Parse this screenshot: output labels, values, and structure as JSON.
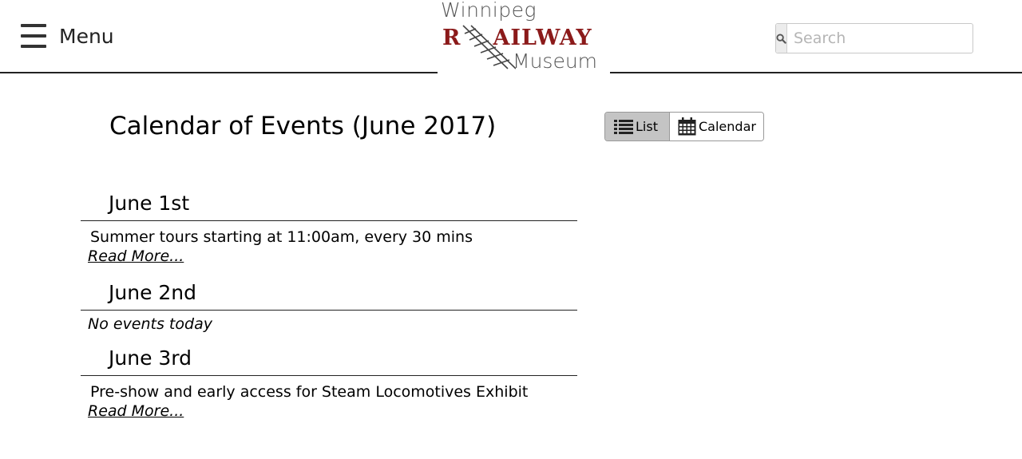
{
  "header": {
    "menu_label": "Menu",
    "logo": {
      "line1": "Winnipeg",
      "line2_left": "R",
      "line2_right": "AILWAY",
      "line3": "Museum"
    },
    "search": {
      "placeholder": "Search",
      "value": ""
    }
  },
  "colors": {
    "logo_red": "#8b1a1a",
    "active_toggle": "#c4c4c4"
  },
  "page": {
    "title": "Calendar of Events (June 2017)",
    "view_toggle": {
      "list_label": "List",
      "calendar_label": "Calendar",
      "active": "List"
    },
    "days": [
      {
        "date": "June 1st",
        "event": "Summer tours starting at 11:00am, every 30 mins",
        "read_more": "Read More..."
      },
      {
        "date": "June 2nd",
        "no_events": "No events today"
      },
      {
        "date": "June 3rd",
        "event": "Pre-show and early access for Steam Locomotives Exhibit",
        "read_more": "Read More..."
      }
    ]
  },
  "icons": [
    "hamburger-icon",
    "search-icon",
    "list-icon",
    "calendar-icon",
    "railway-tracks-icon"
  ]
}
